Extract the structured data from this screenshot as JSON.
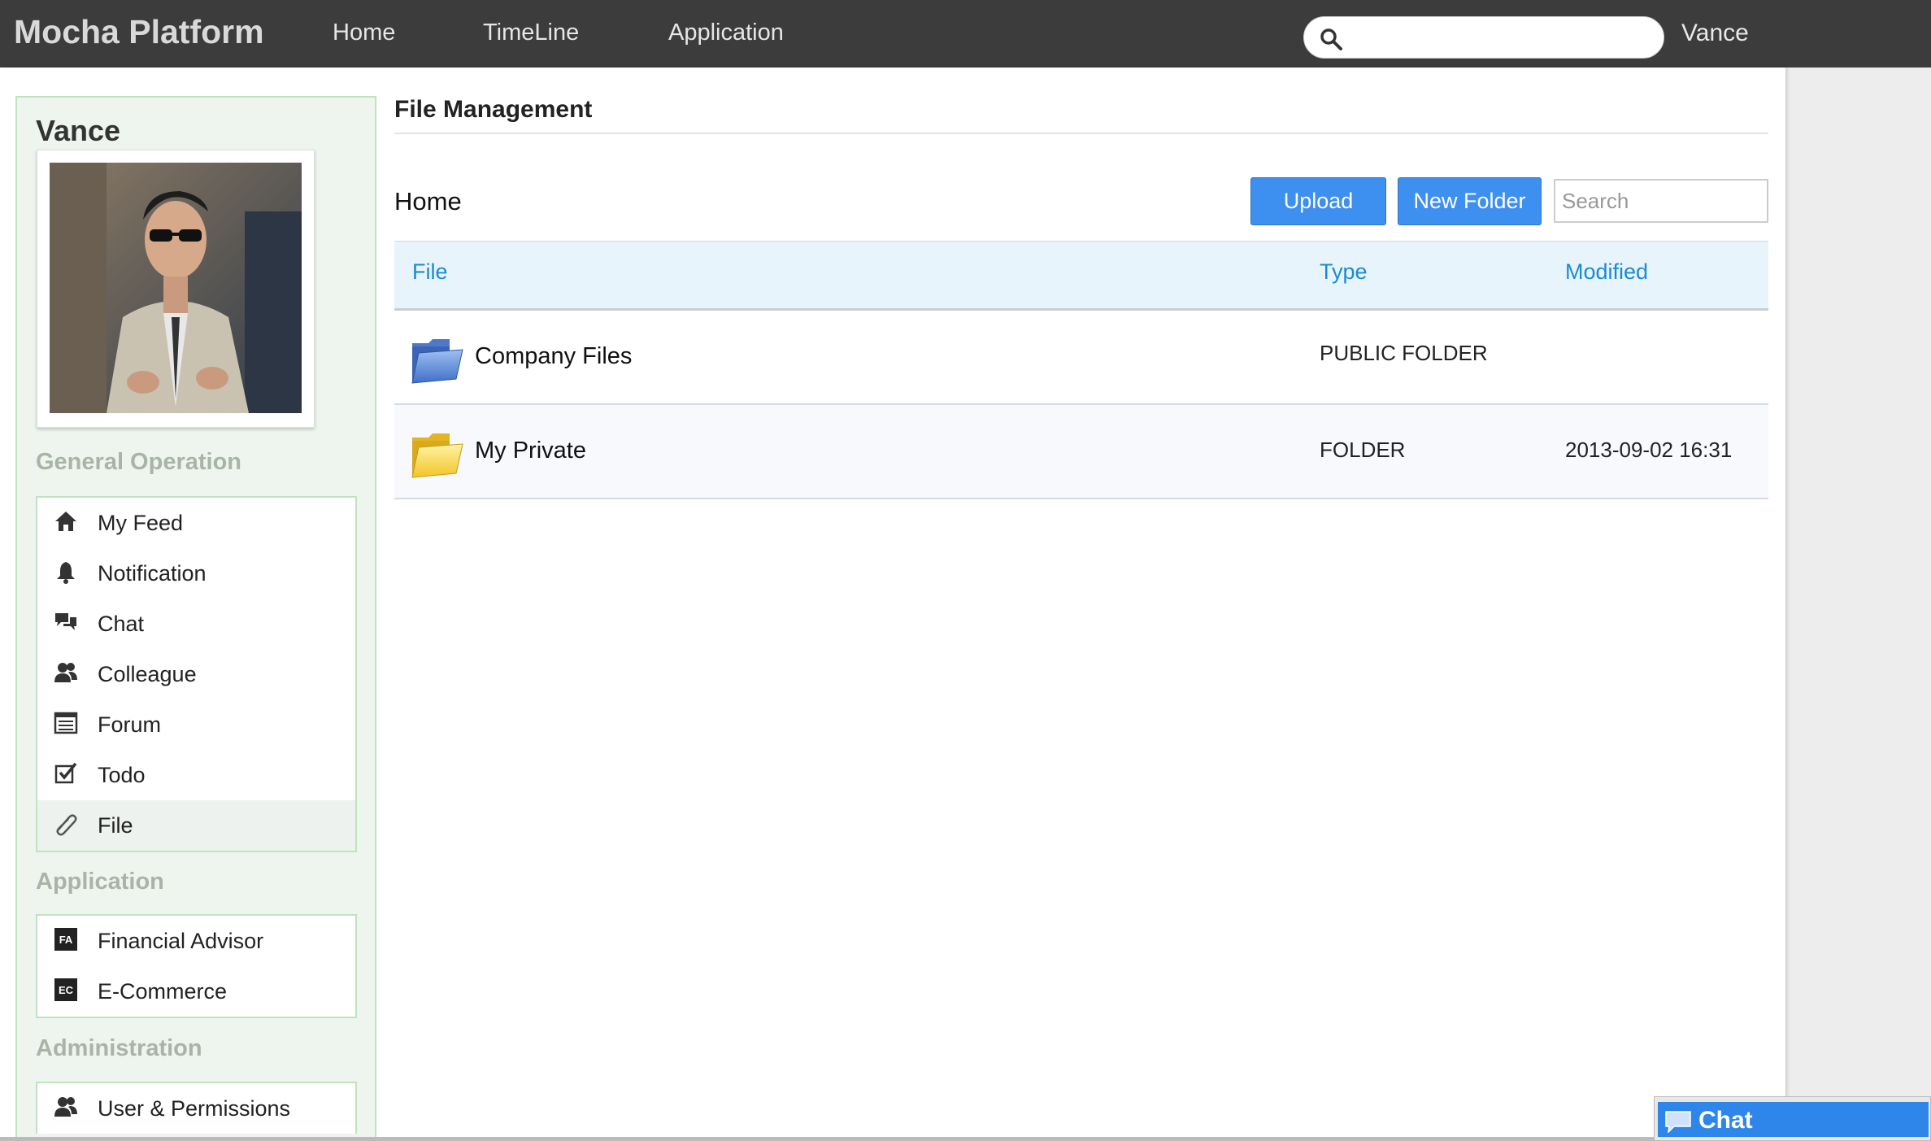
{
  "topbar": {
    "brand": "Mocha Platform",
    "nav": [
      "Home",
      "TimeLine",
      "Application"
    ],
    "search_value": "",
    "user": "Vance"
  },
  "sidebar": {
    "profile_name": "Vance",
    "sections": {
      "general": {
        "title": "General Operation",
        "items": [
          {
            "label": "My Feed",
            "icon": "home-icon"
          },
          {
            "label": "Notification",
            "icon": "bell-icon"
          },
          {
            "label": "Chat",
            "icon": "chat-bubbles-icon"
          },
          {
            "label": "Colleague",
            "icon": "people-icon"
          },
          {
            "label": "Forum",
            "icon": "forum-icon"
          },
          {
            "label": "Todo",
            "icon": "checkbox-icon"
          },
          {
            "label": "File",
            "icon": "paperclip-icon",
            "active": true
          }
        ]
      },
      "application": {
        "title": "Application",
        "items": [
          {
            "label": "Financial Advisor",
            "icon": "fa-badge-icon",
            "badge": "FA"
          },
          {
            "label": "E-Commerce",
            "icon": "ec-badge-icon",
            "badge": "EC"
          }
        ]
      },
      "administration": {
        "title": "Administration",
        "items": [
          {
            "label": "User & Permissions",
            "icon": "people-icon"
          }
        ]
      }
    }
  },
  "main": {
    "title": "File Management",
    "breadcrumb": "Home",
    "upload_label": "Upload",
    "new_folder_label": "New Folder",
    "search_placeholder": "Search",
    "columns": [
      "File",
      "Type",
      "Modified"
    ],
    "rows": [
      {
        "name": "Company Files",
        "type": "PUBLIC FOLDER",
        "modified": "",
        "icon": "blue-folder-icon"
      },
      {
        "name": "My Private",
        "type": "FOLDER",
        "modified": "2013-09-02 16:31",
        "icon": "yellow-folder-icon"
      }
    ]
  },
  "chat_widget": {
    "label": "Chat"
  },
  "colors": {
    "topbar": "#3c3c3c",
    "accent_blue": "#3d8ff0",
    "link_blue": "#1b8ad4",
    "sidebar_bg": "#eef5ee",
    "sidebar_border": "#bfe3bf"
  }
}
